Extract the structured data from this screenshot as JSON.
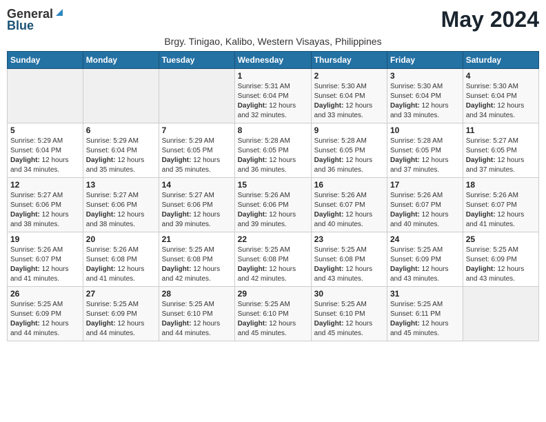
{
  "header": {
    "logo_general": "General",
    "logo_blue": "Blue",
    "month_year": "May 2024",
    "location": "Brgy. Tinigao, Kalibo, Western Visayas, Philippines"
  },
  "days_of_week": [
    "Sunday",
    "Monday",
    "Tuesday",
    "Wednesday",
    "Thursday",
    "Friday",
    "Saturday"
  ],
  "weeks": [
    [
      {
        "day": "",
        "info": ""
      },
      {
        "day": "",
        "info": ""
      },
      {
        "day": "",
        "info": ""
      },
      {
        "day": "1",
        "info": "Sunrise: 5:31 AM\nSunset: 6:04 PM\nDaylight: 12 hours and 32 minutes."
      },
      {
        "day": "2",
        "info": "Sunrise: 5:30 AM\nSunset: 6:04 PM\nDaylight: 12 hours and 33 minutes."
      },
      {
        "day": "3",
        "info": "Sunrise: 5:30 AM\nSunset: 6:04 PM\nDaylight: 12 hours and 33 minutes."
      },
      {
        "day": "4",
        "info": "Sunrise: 5:30 AM\nSunset: 6:04 PM\nDaylight: 12 hours and 34 minutes."
      }
    ],
    [
      {
        "day": "5",
        "info": "Sunrise: 5:29 AM\nSunset: 6:04 PM\nDaylight: 12 hours and 34 minutes."
      },
      {
        "day": "6",
        "info": "Sunrise: 5:29 AM\nSunset: 6:04 PM\nDaylight: 12 hours and 35 minutes."
      },
      {
        "day": "7",
        "info": "Sunrise: 5:29 AM\nSunset: 6:05 PM\nDaylight: 12 hours and 35 minutes."
      },
      {
        "day": "8",
        "info": "Sunrise: 5:28 AM\nSunset: 6:05 PM\nDaylight: 12 hours and 36 minutes."
      },
      {
        "day": "9",
        "info": "Sunrise: 5:28 AM\nSunset: 6:05 PM\nDaylight: 12 hours and 36 minutes."
      },
      {
        "day": "10",
        "info": "Sunrise: 5:28 AM\nSunset: 6:05 PM\nDaylight: 12 hours and 37 minutes."
      },
      {
        "day": "11",
        "info": "Sunrise: 5:27 AM\nSunset: 6:05 PM\nDaylight: 12 hours and 37 minutes."
      }
    ],
    [
      {
        "day": "12",
        "info": "Sunrise: 5:27 AM\nSunset: 6:06 PM\nDaylight: 12 hours and 38 minutes."
      },
      {
        "day": "13",
        "info": "Sunrise: 5:27 AM\nSunset: 6:06 PM\nDaylight: 12 hours and 38 minutes."
      },
      {
        "day": "14",
        "info": "Sunrise: 5:27 AM\nSunset: 6:06 PM\nDaylight: 12 hours and 39 minutes."
      },
      {
        "day": "15",
        "info": "Sunrise: 5:26 AM\nSunset: 6:06 PM\nDaylight: 12 hours and 39 minutes."
      },
      {
        "day": "16",
        "info": "Sunrise: 5:26 AM\nSunset: 6:07 PM\nDaylight: 12 hours and 40 minutes."
      },
      {
        "day": "17",
        "info": "Sunrise: 5:26 AM\nSunset: 6:07 PM\nDaylight: 12 hours and 40 minutes."
      },
      {
        "day": "18",
        "info": "Sunrise: 5:26 AM\nSunset: 6:07 PM\nDaylight: 12 hours and 41 minutes."
      }
    ],
    [
      {
        "day": "19",
        "info": "Sunrise: 5:26 AM\nSunset: 6:07 PM\nDaylight: 12 hours and 41 minutes."
      },
      {
        "day": "20",
        "info": "Sunrise: 5:26 AM\nSunset: 6:08 PM\nDaylight: 12 hours and 41 minutes."
      },
      {
        "day": "21",
        "info": "Sunrise: 5:25 AM\nSunset: 6:08 PM\nDaylight: 12 hours and 42 minutes."
      },
      {
        "day": "22",
        "info": "Sunrise: 5:25 AM\nSunset: 6:08 PM\nDaylight: 12 hours and 42 minutes."
      },
      {
        "day": "23",
        "info": "Sunrise: 5:25 AM\nSunset: 6:08 PM\nDaylight: 12 hours and 43 minutes."
      },
      {
        "day": "24",
        "info": "Sunrise: 5:25 AM\nSunset: 6:09 PM\nDaylight: 12 hours and 43 minutes."
      },
      {
        "day": "25",
        "info": "Sunrise: 5:25 AM\nSunset: 6:09 PM\nDaylight: 12 hours and 43 minutes."
      }
    ],
    [
      {
        "day": "26",
        "info": "Sunrise: 5:25 AM\nSunset: 6:09 PM\nDaylight: 12 hours and 44 minutes."
      },
      {
        "day": "27",
        "info": "Sunrise: 5:25 AM\nSunset: 6:09 PM\nDaylight: 12 hours and 44 minutes."
      },
      {
        "day": "28",
        "info": "Sunrise: 5:25 AM\nSunset: 6:10 PM\nDaylight: 12 hours and 44 minutes."
      },
      {
        "day": "29",
        "info": "Sunrise: 5:25 AM\nSunset: 6:10 PM\nDaylight: 12 hours and 45 minutes."
      },
      {
        "day": "30",
        "info": "Sunrise: 5:25 AM\nSunset: 6:10 PM\nDaylight: 12 hours and 45 minutes."
      },
      {
        "day": "31",
        "info": "Sunrise: 5:25 AM\nSunset: 6:11 PM\nDaylight: 12 hours and 45 minutes."
      },
      {
        "day": "",
        "info": ""
      }
    ]
  ]
}
